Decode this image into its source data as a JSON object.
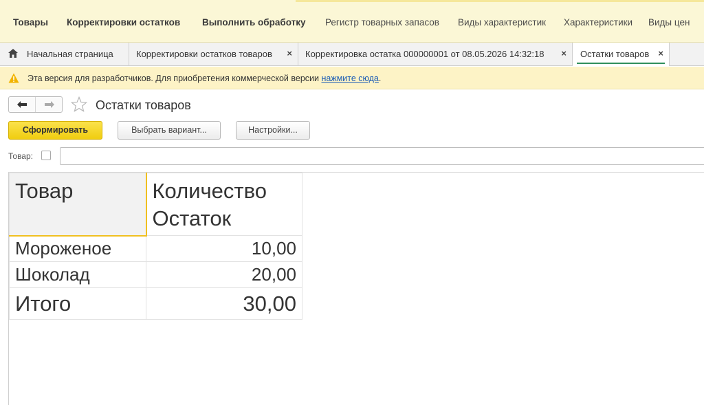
{
  "topbar": {
    "items": [
      {
        "label": "Товары"
      },
      {
        "label": "Корректировки остатков"
      },
      {
        "label": "Выполнить обработку"
      },
      {
        "label": "Регистр товарных запасов"
      },
      {
        "label": "Виды характеристик"
      },
      {
        "label": "Характеристики"
      },
      {
        "label": "Виды цен"
      }
    ]
  },
  "tabs": [
    {
      "label": "Начальная страница",
      "icon": "home-icon"
    },
    {
      "label": "Корректировки остатков товаров",
      "close": "×"
    },
    {
      "label": "Корректировка остатка 000000001 от 08.05.2026 14:32:18",
      "close": "×"
    },
    {
      "label": "Остатки товаров",
      "close": "×",
      "active": true
    }
  ],
  "warning": {
    "text": "Эта версия для разработчиков. Для приобретения коммерческой версии ",
    "link": "нажмите сюда",
    "suffix": "."
  },
  "form": {
    "back": "🡐",
    "forward": "🡒",
    "title": "Остатки товаров"
  },
  "commands": {
    "generate": "Сформировать",
    "choose_variant": "Выбрать вариант...",
    "settings": "Настройки..."
  },
  "filter": {
    "label": "Товар:",
    "value": ""
  },
  "report": {
    "headers": [
      "Товар",
      "Количество",
      "Остаток"
    ],
    "rows": [
      {
        "product": "Мороженое",
        "qty": "10,00"
      },
      {
        "product": "Шоколад",
        "qty": "20,00"
      }
    ],
    "total": {
      "label": "Итого",
      "qty": "30,00"
    }
  },
  "colors": {
    "accent_yellow": "#f0cd10",
    "topbar_bg": "#fbf7d6",
    "warning_bg": "#fdf3c6",
    "active_tab_underline": "#2f8f5b"
  }
}
